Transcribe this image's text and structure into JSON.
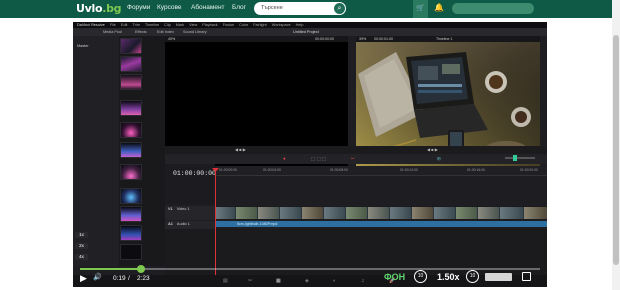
{
  "site": {
    "logo_main": "Uvlo",
    "logo_domain": ".bg",
    "nav": [
      "Форуми",
      "Курсове",
      "Абонамент",
      "Блог"
    ],
    "search_placeholder": "Търсене"
  },
  "app": {
    "window_title": "DaVinci Resolve",
    "menu": [
      "File",
      "Edit",
      "Trim",
      "Timeline",
      "Clip",
      "Mark",
      "View",
      "Playback",
      "Fusion",
      "Color",
      "Fairlight",
      "Workspace",
      "Help"
    ],
    "toolbar_items": [
      "Media Pool",
      "Effects",
      "Edit Index",
      "Sound Library"
    ],
    "project_name": "Untitled Project",
    "source_zoom": "40%",
    "source_tc": "00:00:00:00",
    "program_zoom": "39%",
    "program_name": "Timeline 1",
    "program_tc": "00:00:01:00",
    "bin_label": "Master",
    "timeline_timecode": "01:00:00:00",
    "ruler_labels": [
      "01:00:00:00",
      "01:00:04:00",
      "01:00:08:00",
      "01:00:12:00",
      "01:00:16:00",
      "01:00:20:00"
    ],
    "video_track_name": "Video 1",
    "video_track_id": "V1",
    "audio_track_name": "Audio 1",
    "audio_track_id": "A1",
    "audio_clip_label": "5cm-lightbulb-1080P.mp4"
  },
  "player": {
    "current_time": "0:19",
    "separator": "/",
    "duration": "2:23",
    "progress": 0.133,
    "side_buttons": [
      "1x",
      "2x",
      "4x"
    ],
    "background_label": "ФОН",
    "speed": "1.50x",
    "rewind_label": "10",
    "forward_label": "10"
  },
  "colors": {
    "brand": "#0f5a47",
    "accent": "#7ec850",
    "playhead": "#e0303a",
    "audio_clip": "#2c6fa0"
  }
}
